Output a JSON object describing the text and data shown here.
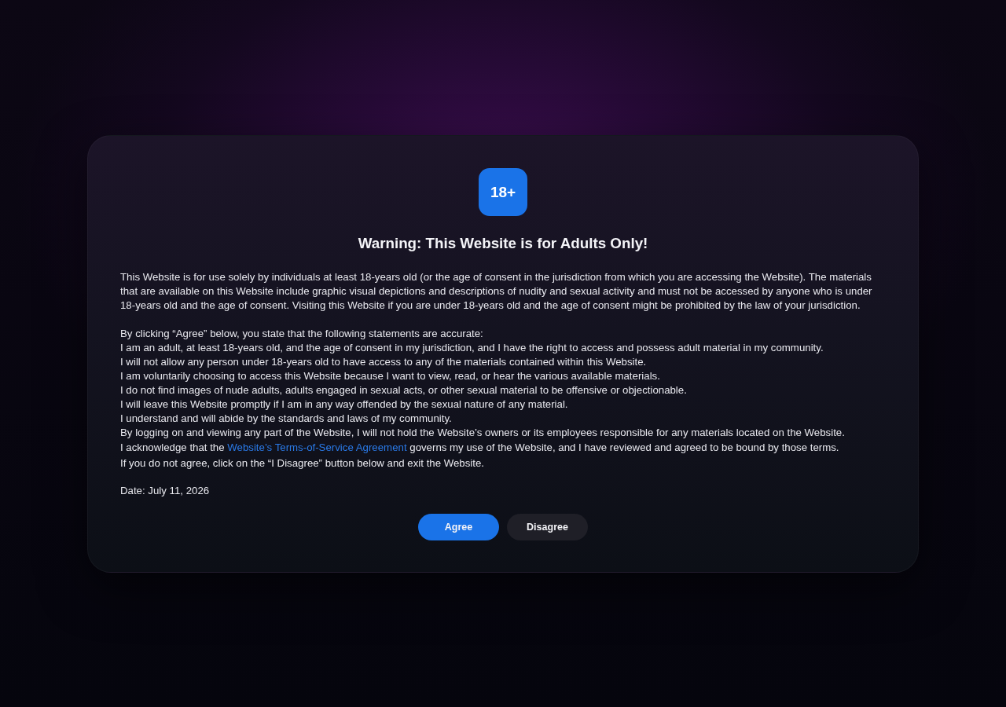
{
  "badge": {
    "text": "18+"
  },
  "title": "Warning: This Website is for Adults Only!",
  "intro": "This Website is for use solely by individuals at least 18-years old (or the age of consent in the jurisdiction from which you are accessing the Website). The materials that are available on this Website include graphic visual depictions and descriptions of nudity and sexual activity and must not be accessed by anyone who is under 18-years old and the age of consent. Visiting this Website if you are under 18-years old and the age of consent might be prohibited by the law of your jurisdiction.",
  "statements_heading": "By clicking “Agree” below, you state that the following statements are accurate:",
  "statements": [
    "I am an adult, at least 18-years old, and the age of consent in my jurisdiction, and I have the right to access and possess adult material in my community.",
    "I will not allow any person under 18-years old to have access to any of the materials contained within this Website.",
    "I am voluntarily choosing to access this Website because I want to view, read, or hear the various available materials.",
    "I do not find images of nude adults, adults engaged in sexual acts, or other sexual material to be offensive or objectionable.",
    "I will leave this Website promptly if I am in any way offended by the sexual nature of any material.",
    "I understand and will abide by the standards and laws of my community.",
    "By logging on and viewing any part of the Website, I will not hold the Website’s owners or its employees responsible for any materials located on the Website."
  ],
  "acknowledgement": {
    "before": "I acknowledge that the",
    "link": "Website’s Terms-of-Service Agreement",
    "after": "governs my use of the Website, and I have reviewed and agreed to be bound by those terms."
  },
  "exit_note": "If you do not agree, click on the “I Disagree” button below and exit the Website.",
  "date": "Date: July 11, 2026",
  "buttons": [
    {
      "label": "Agree",
      "kind": "primary"
    },
    {
      "label": "Disagree",
      "kind": "secondary"
    }
  ]
}
